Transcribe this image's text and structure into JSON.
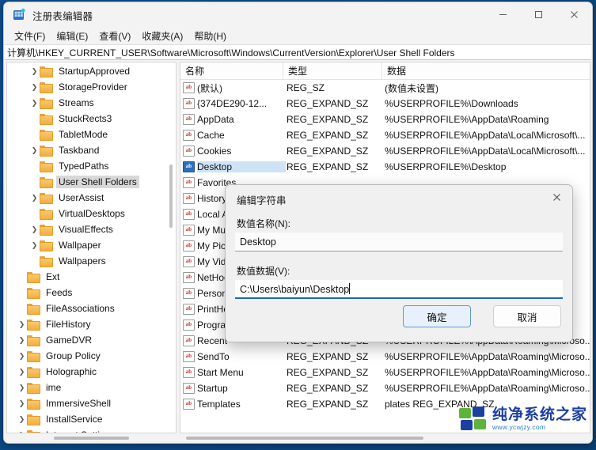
{
  "window": {
    "title": "注册表编辑器",
    "icon": "registry-editor-icon",
    "controls": {
      "minimize": "–",
      "maximize": "□",
      "close": "✕"
    }
  },
  "menubar": {
    "items": [
      {
        "label": "文件(F)"
      },
      {
        "label": "编辑(E)"
      },
      {
        "label": "查看(V)"
      },
      {
        "label": "收藏夹(A)"
      },
      {
        "label": "帮助(H)"
      }
    ]
  },
  "address": {
    "path": "计算机\\HKEY_CURRENT_USER\\Software\\Microsoft\\Windows\\CurrentVersion\\Explorer\\User Shell Folders"
  },
  "tree": {
    "items": [
      {
        "label": "StartupApproved",
        "expandable": true,
        "indent": 2,
        "selected": false
      },
      {
        "label": "StorageProvider",
        "expandable": true,
        "indent": 2,
        "selected": false
      },
      {
        "label": "Streams",
        "expandable": true,
        "indent": 2,
        "selected": false
      },
      {
        "label": "StuckRects3",
        "expandable": false,
        "indent": 2,
        "selected": false
      },
      {
        "label": "TabletMode",
        "expandable": false,
        "indent": 2,
        "selected": false
      },
      {
        "label": "Taskband",
        "expandable": true,
        "indent": 2,
        "selected": false
      },
      {
        "label": "TypedPaths",
        "expandable": false,
        "indent": 2,
        "selected": false
      },
      {
        "label": "User Shell Folders",
        "expandable": false,
        "indent": 2,
        "selected": true
      },
      {
        "label": "UserAssist",
        "expandable": true,
        "indent": 2,
        "selected": false
      },
      {
        "label": "VirtualDesktops",
        "expandable": false,
        "indent": 2,
        "selected": false
      },
      {
        "label": "VisualEffects",
        "expandable": true,
        "indent": 2,
        "selected": false
      },
      {
        "label": "Wallpaper",
        "expandable": true,
        "indent": 2,
        "selected": false
      },
      {
        "label": "Wallpapers",
        "expandable": false,
        "indent": 2,
        "selected": false
      },
      {
        "label": "Ext",
        "expandable": false,
        "indent": 1,
        "selected": false
      },
      {
        "label": "Feeds",
        "expandable": false,
        "indent": 1,
        "selected": false
      },
      {
        "label": "FileAssociations",
        "expandable": false,
        "indent": 1,
        "selected": false
      },
      {
        "label": "FileHistory",
        "expandable": true,
        "indent": 1,
        "selected": false
      },
      {
        "label": "GameDVR",
        "expandable": true,
        "indent": 1,
        "selected": false
      },
      {
        "label": "Group Policy",
        "expandable": true,
        "indent": 1,
        "selected": false
      },
      {
        "label": "Holographic",
        "expandable": true,
        "indent": 1,
        "selected": false
      },
      {
        "label": "ime",
        "expandable": true,
        "indent": 1,
        "selected": false
      },
      {
        "label": "ImmersiveShell",
        "expandable": true,
        "indent": 1,
        "selected": false
      },
      {
        "label": "InstallService",
        "expandable": true,
        "indent": 1,
        "selected": false
      },
      {
        "label": "Internet Settings",
        "expandable": true,
        "indent": 1,
        "selected": false
      }
    ]
  },
  "list": {
    "columns": [
      {
        "label": "名称"
      },
      {
        "label": "类型"
      },
      {
        "label": "数据"
      }
    ],
    "rows": [
      {
        "name": "(默认)",
        "type": "REG_SZ",
        "data": "(数值未设置)",
        "selected": false
      },
      {
        "name": "{374DE290-12...",
        "type": "REG_EXPAND_SZ",
        "data": "%USERPROFILE%\\Downloads",
        "selected": false
      },
      {
        "name": "AppData",
        "type": "REG_EXPAND_SZ",
        "data": "%USERPROFILE%\\AppData\\Roaming",
        "selected": false
      },
      {
        "name": "Cache",
        "type": "REG_EXPAND_SZ",
        "data": "%USERPROFILE%\\AppData\\Local\\Microsoft\\...",
        "selected": false
      },
      {
        "name": "Cookies",
        "type": "REG_EXPAND_SZ",
        "data": "%USERPROFILE%\\AppData\\Local\\Microsoft\\...",
        "selected": false
      },
      {
        "name": "Desktop",
        "type": "REG_EXPAND_SZ",
        "data": "%USERPROFILE%\\Desktop",
        "selected": true
      },
      {
        "name": "Favorites",
        "type": "",
        "data": "",
        "selected": false
      },
      {
        "name": "History",
        "type": "",
        "data": "t\\...",
        "selected": false
      },
      {
        "name": "Local AppData",
        "type": "",
        "data": "",
        "selected": false
      },
      {
        "name": "My Music",
        "type": "",
        "data": "",
        "selected": false
      },
      {
        "name": "My Pictures",
        "type": "",
        "data": "",
        "selected": false
      },
      {
        "name": "My Video",
        "type": "",
        "data": "",
        "selected": false
      },
      {
        "name": "NetHood",
        "type": "",
        "data": "",
        "selected": false
      },
      {
        "name": "Personal",
        "type": "",
        "data": "oso...",
        "selected": false
      },
      {
        "name": "PrintHood",
        "type": "",
        "data": "",
        "selected": false
      },
      {
        "name": "Programs",
        "type": "",
        "data": "oso...",
        "selected": false
      },
      {
        "name": "Recent",
        "type": "REG_EXPAND_SZ",
        "data": "%USERPROFILE%\\AppData\\Roaming\\Microso...",
        "selected": false
      },
      {
        "name": "SendTo",
        "type": "REG_EXPAND_SZ",
        "data": "%USERPROFILE%\\AppData\\Roaming\\Microso...",
        "selected": false
      },
      {
        "name": "Start Menu",
        "type": "REG_EXPAND_SZ",
        "data": "%USERPROFILE%\\AppData\\Roaming\\Microso...",
        "selected": false
      },
      {
        "name": "Startup",
        "type": "REG_EXPAND_SZ",
        "data": "%USERPROFILE%\\AppData\\Roaming\\Microso...",
        "selected": false
      },
      {
        "name": "Templates",
        "type": "REG_EXPAND_SZ",
        "data": "plates        REG_EXPAND_SZ",
        "selected": false
      }
    ]
  },
  "dialog": {
    "title": "编辑字符串",
    "close_icon": "✕",
    "name_label": "数值名称(N):",
    "name_value": "Desktop",
    "data_label": "数值数据(V):",
    "data_value": "C:\\Users\\baiyun\\Desktop",
    "ok_label": "确定",
    "cancel_label": "取消",
    "highlight_color": "#e8202a",
    "accent_color": "#1767b5"
  },
  "watermark": {
    "title": "纯净系统之家",
    "url": "www.ycwjzy.com"
  }
}
